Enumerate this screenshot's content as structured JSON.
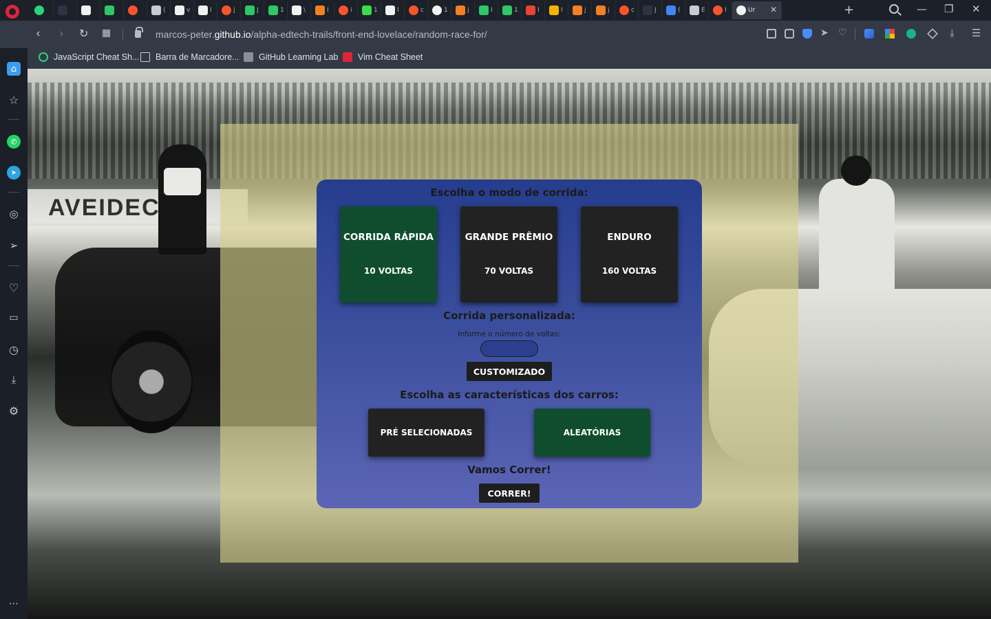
{
  "browser": {
    "tabs": [
      {
        "icon": "pluralsight-icon",
        "title": "",
        "color": "#2bd47c"
      },
      {
        "icon": "lambda-icon",
        "title": "",
        "color": "#2b3442"
      },
      {
        "icon": "github-icon",
        "title": "",
        "color": "#f1f1f1"
      },
      {
        "icon": "hackerrank-icon",
        "title": "",
        "color": "#2ec866"
      },
      {
        "icon": "brave-icon",
        "title": "",
        "color": "#fb542b"
      },
      {
        "icon": "gear-icon",
        "title": "(",
        "color": "#c7cbd2"
      },
      {
        "icon": "hat-icon",
        "title": "v",
        "color": "#f1f1f1"
      },
      {
        "icon": "hat-icon",
        "title": "I",
        "color": "#f1f1f1"
      },
      {
        "icon": "brave-icon",
        "title": "j",
        "color": "#fb542b"
      },
      {
        "icon": "w-icon",
        "title": "J",
        "color": "#2ec866"
      },
      {
        "icon": "w-icon",
        "title": "1",
        "color": "#2ec866"
      },
      {
        "icon": "hat-icon",
        "title": "\\",
        "color": "#f1f1f1"
      },
      {
        "icon": "stackoverflow-icon",
        "title": "I",
        "color": "#f48024"
      },
      {
        "icon": "brave-icon",
        "title": "i",
        "color": "#fb542b"
      },
      {
        "icon": "power-icon",
        "title": "1",
        "color": "#3bdc4b"
      },
      {
        "icon": "code-icon",
        "title": "I",
        "color": "#f1f1f1"
      },
      {
        "icon": "brave-icon",
        "title": "c",
        "color": "#fb542b"
      },
      {
        "icon": "globe-icon",
        "title": "1",
        "color": "#f1f1f1"
      },
      {
        "icon": "stackoverflow-icon",
        "title": "j",
        "color": "#f48024"
      },
      {
        "icon": "w-icon",
        "title": "I",
        "color": "#2ec866"
      },
      {
        "icon": "w-icon",
        "title": "1",
        "color": "#2ec866"
      },
      {
        "icon": "gmail-icon",
        "title": "I",
        "color": "#ea4335"
      },
      {
        "icon": "folder-icon",
        "title": "I",
        "color": "#f4b400"
      },
      {
        "icon": "stackoverflow-icon",
        "title": "j",
        "color": "#f48024"
      },
      {
        "icon": "stackoverflow-icon",
        "title": "j",
        "color": "#f48024"
      },
      {
        "icon": "brave-icon",
        "title": "c",
        "color": "#fb542b"
      },
      {
        "icon": "lambda-icon",
        "title": "J",
        "color": "#2b3442"
      },
      {
        "icon": "translate-icon",
        "title": "(",
        "color": "#4285f4"
      },
      {
        "icon": "gear-icon",
        "title": "E",
        "color": "#c7cbd2"
      },
      {
        "icon": "brave-icon",
        "title": "I",
        "color": "#fb542b"
      },
      {
        "icon": "globe-icon",
        "title": "Ur",
        "color": "#f1f1f1",
        "active": true
      }
    ],
    "url_prefix": "marcos-peter.",
    "url_host": "github.io",
    "url_path": "/alpha-edtech-trails/front-end-lovelace/random-race-for/",
    "bookmarks": [
      {
        "label": "JavaScript Cheat Sh...",
        "icon": "pluralsight-icon",
        "color": "#2bd47c"
      },
      {
        "label": "Barra de Marcadore...",
        "icon": "folder-icon",
        "color": "#c7cbd2"
      },
      {
        "label": "GitHub Learning Lab",
        "icon": "printer-icon",
        "color": "#c7cbd2"
      },
      {
        "label": "Vim Cheat Sheet",
        "icon": "vim-icon",
        "color": "#e0243b"
      }
    ]
  },
  "page": {
    "mode_title": "Escolha o modo de corrida:",
    "modes": [
      {
        "name": "CORRIDA RÁPIDA",
        "laps": "10 VOLTAS",
        "selected": true
      },
      {
        "name": "GRANDE PRÊMIO",
        "laps": "70 VOLTAS",
        "selected": false
      },
      {
        "name": "ENDURO",
        "laps": "160 VOLTAS",
        "selected": false
      }
    ],
    "custom_title": "Corrida personalizada:",
    "laps_label": "Informe o número de voltas:",
    "laps_value": "",
    "custom_button": "CUSTOMIZADO",
    "cars_title": "Escolha as características dos carros:",
    "car_options": [
      {
        "label": "PRÉ SELECIONADAS",
        "selected": false
      },
      {
        "label": "ALEATÓRIAS",
        "selected": true
      }
    ],
    "go_title": "Vamos Correr!",
    "go_button": "CORRER!",
    "colors": {
      "panel_top": "#263d8e",
      "panel_bottom": "#5c65b5",
      "selected": "#0f4d2e",
      "unselected": "#222222",
      "overlay": "#d6d08c"
    }
  }
}
